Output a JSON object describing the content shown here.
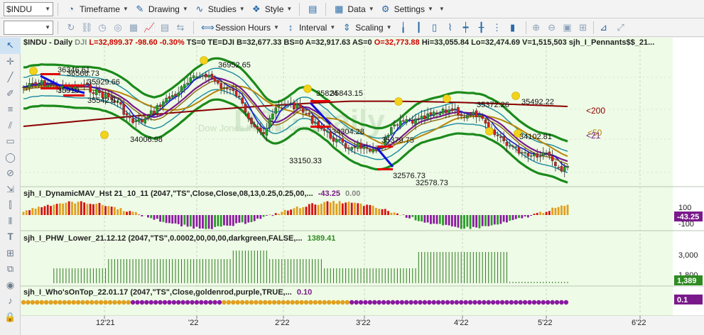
{
  "toolbar1": {
    "symbol": "$INDU",
    "timeframe": "Timeframe",
    "drawing": "Drawing",
    "studies": "Studies",
    "style": "Style",
    "data": "Data",
    "settings": "Settings"
  },
  "toolbar2": {
    "session_hours": "Session Hours",
    "interval": "Interval",
    "scaling": "Scaling"
  },
  "header": {
    "symbol": "$INDU - Daily",
    "exchange": "DJI",
    "last": "L=32,899.37",
    "change": "-98.60",
    "pct": "-0.30%",
    "ts": "TS=0",
    "te": "TE=DJI",
    "bid": "B=32,677.33",
    "bs": "BS=0",
    "ask": "A=32,917.63",
    "as": "AS=0",
    "open": "O=32,773.88",
    "hi": "Hi=33,055.84",
    "lo": "Lo=32,474.69",
    "vol": "V=1,515,503",
    "study": "sjh_I_Pennants$$_21..."
  },
  "panels": {
    "p2": {
      "name": "sjh_I_DynamicMAV_Hst 21_10_11 (2047,\"TS\",Close,Close,08,13,0.25,0.25,00,...",
      "v1": "-43.25",
      "v2": "0.00",
      "axis": [
        "100",
        "-100"
      ],
      "badge": "-43.25"
    },
    "p3": {
      "name": "sjh_I_PHW_Lower_21.12.12 (2047,\"TS\",0.0002,00,00,00,darkgreen,FALSE,...",
      "v1": "1389.41",
      "axis": [
        "3,000",
        "1,800"
      ],
      "badge": "1,389"
    },
    "p4": {
      "name": "sjh_I_Who'sOnTop_22.01.17 (2047,\"TS\",Close,goldenrod,purple,TRUE,...",
      "v1": "0.10",
      "badge": "0.1"
    }
  },
  "price_labels": [
    "36346.61",
    "36566.73",
    "35929.66",
    "35910",
    "35542.87",
    "34006.98",
    "36952.65",
    "35824",
    "35843.15",
    "34304.28",
    "33150.33",
    "35379.75",
    "32578.73",
    "32576.73",
    "35372.26",
    "35492.22",
    "34102.81"
  ],
  "right_labels": {
    "l200": "<200",
    "l50": "<50",
    "l21": "<21"
  },
  "watermark": "Dow Jones Industrial Average",
  "time_axis": [
    "12'21",
    "'22",
    "2'22",
    "3'22",
    "4'22",
    "5'22",
    "6'22"
  ],
  "colors": {
    "bull": "#1fa01f",
    "bear": "#c80000",
    "band": "#1a8a1a",
    "ma200": "#8b0000",
    "ma50": "#b8860b"
  }
}
